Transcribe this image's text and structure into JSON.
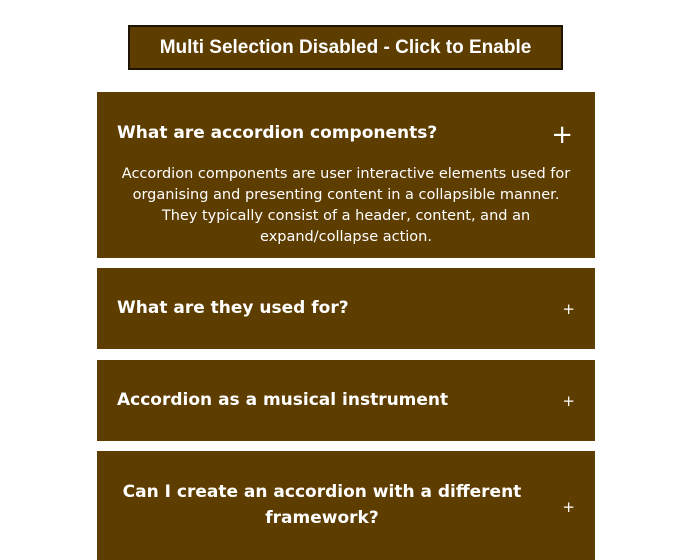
{
  "toggle": {
    "label": "Multi Selection Disabled - Click to Enable"
  },
  "accordion": {
    "items": [
      {
        "title": "What are accordion components?",
        "icon": "+",
        "expanded": true,
        "content": "Accordion components are user interactive elements used for organising and presenting content in a collapsible manner. They typically consist of a header, content, and an expand/collapse action."
      },
      {
        "title": "What are they used for?",
        "icon": "+",
        "expanded": false
      },
      {
        "title": "Accordion as a musical instrument",
        "icon": "+",
        "expanded": false
      },
      {
        "title": "Can I create an accordion with a different framework?",
        "icon": "+",
        "expanded": false
      }
    ]
  },
  "colors": {
    "panel": "#5e3d00",
    "text": "#ffffff",
    "background": "#ffffff"
  }
}
